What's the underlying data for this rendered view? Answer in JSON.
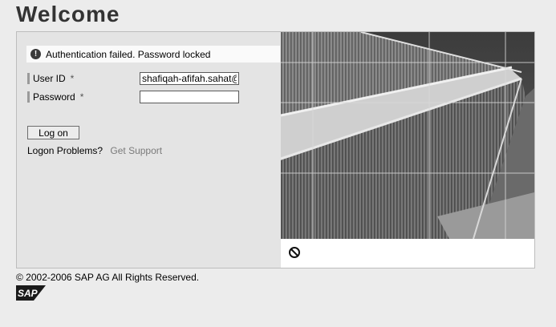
{
  "page": {
    "title": "Welcome"
  },
  "login": {
    "message": "Authentication failed. Password locked",
    "message_icon": "exclamation-icon",
    "user_id_label": "User ID",
    "password_label": "Password",
    "required_marker": "*",
    "user_id_value": "shafiqah-afifah.sahat@",
    "password_value": "",
    "logon_button": "Log on",
    "problems_text": "Logon Problems?",
    "support_link": "Get Support"
  },
  "footer": {
    "copyright": "© 2002-2006 SAP AG All Rights Reserved.",
    "logo_text": "SAP"
  },
  "image": {
    "status_icon": "blocked-icon"
  }
}
